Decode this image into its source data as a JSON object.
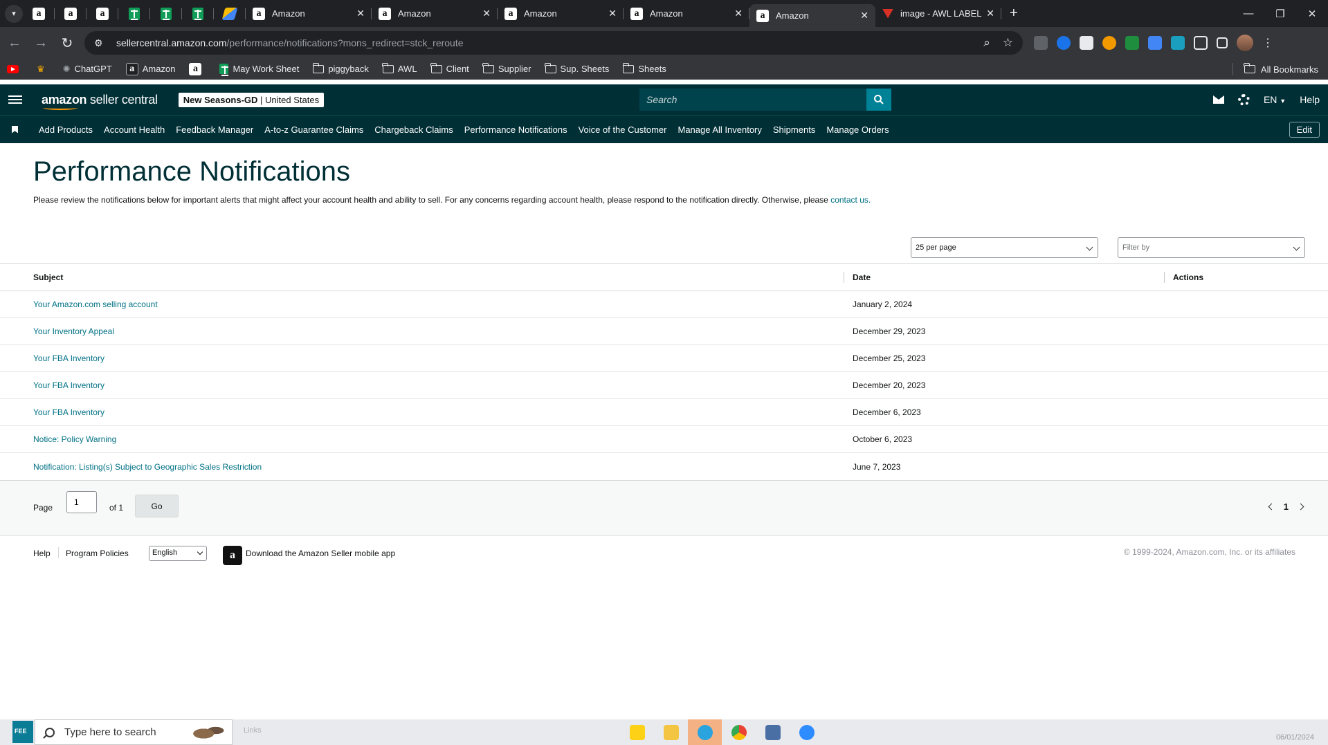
{
  "browser": {
    "tabs": [
      {
        "title": "Amazon"
      },
      {
        "title": "Amazon"
      },
      {
        "title": "Amazon"
      },
      {
        "title": "Amazon"
      },
      {
        "title": "Amazon"
      },
      {
        "title": "image - AWL LABEL"
      }
    ],
    "url_host": "sellercentral.amazon.com",
    "url_path": "/performance/notifications?mons_redirect=stck_reroute",
    "bookmarks": [
      {
        "label": "ChatGPT"
      },
      {
        "label": "Amazon"
      },
      {
        "label": ""
      },
      {
        "label": "May Work Sheet"
      },
      {
        "label": "piggyback"
      },
      {
        "label": "AWL"
      },
      {
        "label": "Client"
      },
      {
        "label": "Supplier"
      },
      {
        "label": "Sup. Sheets"
      },
      {
        "label": "Sheets"
      }
    ],
    "all_bookmarks": "All Bookmarks"
  },
  "header": {
    "logo_bold": "amazon",
    "logo_rest": " seller central",
    "account_name": "New Seasons-GD",
    "account_region": " | United States",
    "search_placeholder": "Search",
    "language": "EN",
    "help": "Help"
  },
  "nav": {
    "items": [
      "Add Products",
      "Account Health",
      "Feedback Manager",
      "A-to-z Guarantee Claims",
      "Chargeback Claims",
      "Performance Notifications",
      "Voice of the Customer",
      "Manage All Inventory",
      "Shipments",
      "Manage Orders"
    ],
    "edit": "Edit"
  },
  "page": {
    "title": "Performance Notifications",
    "intro": "Please review the notifications below for important alerts that might affect your account health and ability to sell. For any concerns regarding account health, please respond to the notification directly. Otherwise, please ",
    "contact_link": "contact us.",
    "per_page": "25 per page",
    "filter_placeholder": "Filter by"
  },
  "table": {
    "headers": {
      "subject": "Subject",
      "date": "Date",
      "actions": "Actions"
    },
    "rows": [
      {
        "subject": "Your Amazon.com selling account",
        "date": "January 2, 2024"
      },
      {
        "subject": "Your Inventory Appeal",
        "date": "December 29, 2023"
      },
      {
        "subject": "Your FBA Inventory",
        "date": "December 25, 2023"
      },
      {
        "subject": "Your FBA Inventory",
        "date": "December 20, 2023"
      },
      {
        "subject": "Your FBA Inventory",
        "date": "December 6, 2023"
      },
      {
        "subject": "Notice: Policy Warning",
        "date": "October 6, 2023"
      },
      {
        "subject": "Notification: Listing(s) Subject to Geographic Sales Restriction",
        "date": "June 7, 2023"
      }
    ]
  },
  "pagination": {
    "page_label": "Page",
    "page_value": "1",
    "of_label": "of 1",
    "go": "Go",
    "current": "1"
  },
  "footer": {
    "help": "Help",
    "program_policies": "Program Policies",
    "language": "English",
    "app_text": "Download the Amazon Seller mobile app",
    "copyright": "© 1999-2024, Amazon.com, Inc. or its affiliates"
  },
  "taskbar": {
    "search_placeholder": "Type here to search",
    "links": "Links",
    "widget": "FEE",
    "date": "06/01/2024"
  }
}
